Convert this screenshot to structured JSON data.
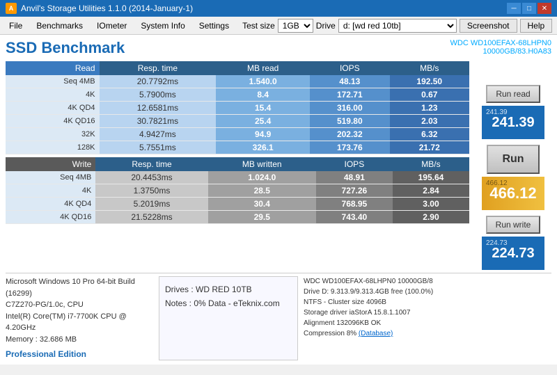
{
  "titlebar": {
    "title": "Anvil's Storage Utilities 1.1.0 (2014-January-1)",
    "icon": "A"
  },
  "menu": {
    "items": [
      "File",
      "Benchmarks",
      "IOmeter",
      "System Info",
      "Settings"
    ]
  },
  "toolbar": {
    "test_size_label": "Test size",
    "test_size_value": "1GB",
    "drive_label": "Drive",
    "drive_value": "d: [wd red 10tb]",
    "screenshot_label": "Screenshot",
    "help_label": "Help"
  },
  "header": {
    "title": "SSD Benchmark",
    "drive_line1": "WDC WD100EFAX-68LHPN0",
    "drive_line2": "10000GB/83.H0A83"
  },
  "read_table": {
    "headers": [
      "Read",
      "Resp. time",
      "MB read",
      "IOPS",
      "MB/s"
    ],
    "rows": [
      {
        "label": "Seq 4MB",
        "resp": "20.7792ms",
        "mb": "1.540.0",
        "iops": "48.13",
        "mbs": "192.50"
      },
      {
        "label": "4K",
        "resp": "5.7900ms",
        "mb": "8.4",
        "iops": "172.71",
        "mbs": "0.67"
      },
      {
        "label": "4K QD4",
        "resp": "12.6581ms",
        "mb": "15.4",
        "iops": "316.00",
        "mbs": "1.23"
      },
      {
        "label": "4K QD16",
        "resp": "30.7821ms",
        "mb": "25.4",
        "iops": "519.80",
        "mbs": "2.03"
      },
      {
        "label": "32K",
        "resp": "4.9427ms",
        "mb": "94.9",
        "iops": "202.32",
        "mbs": "6.32"
      },
      {
        "label": "128K",
        "resp": "5.7551ms",
        "mb": "326.1",
        "iops": "173.76",
        "mbs": "21.72"
      }
    ]
  },
  "write_table": {
    "headers": [
      "Write",
      "Resp. time",
      "MB written",
      "IOPS",
      "MB/s"
    ],
    "rows": [
      {
        "label": "Seq 4MB",
        "resp": "20.4453ms",
        "mb": "1.024.0",
        "iops": "48.91",
        "mbs": "195.64"
      },
      {
        "label": "4K",
        "resp": "1.3750ms",
        "mb": "28.5",
        "iops": "727.26",
        "mbs": "2.84"
      },
      {
        "label": "4K QD4",
        "resp": "5.2019ms",
        "mb": "30.4",
        "iops": "768.95",
        "mbs": "3.00"
      },
      {
        "label": "4K QD16",
        "resp": "21.5228ms",
        "mb": "29.5",
        "iops": "743.40",
        "mbs": "2.90"
      }
    ]
  },
  "scores": {
    "read_label": "241.39",
    "read_value": "241.39",
    "total_label": "466.12",
    "total_value": "466.12",
    "write_label": "224.73",
    "write_value": "224.73",
    "run_label": "Run",
    "run_read_label": "Run read",
    "run_write_label": "Run write"
  },
  "bottom": {
    "system_info": [
      "Microsoft Windows 10 Pro 64-bit Build (16299)",
      "C7Z270-PG/1.0c, CPU",
      "Intel(R) Core(TM) i7-7700K CPU @ 4.20GHz",
      "Memory : 32.686 MB"
    ],
    "pro_edition": "Professional Edition",
    "drives_label": "Drives : WD RED 10TB",
    "notes_label": "Notes : 0% Data - eTeknix.com",
    "right_info": [
      "WDC WD100EFAX-68LHPN0 10000GB/8",
      "Drive D: 9.313.9/9.313.4GB free (100.0%)",
      "NTFS - Cluster size 4096B",
      "Storage driver  iaStorA 15.8.1.1007",
      "",
      "Alignment 132096KB OK",
      "Compression 8% (Database)"
    ]
  }
}
